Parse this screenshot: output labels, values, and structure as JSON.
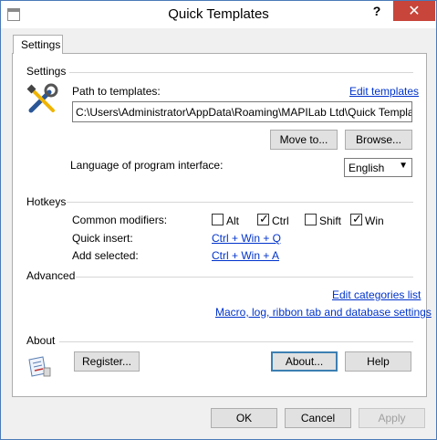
{
  "window": {
    "title": "Quick Templates",
    "help_glyph": "?",
    "close_glyph": "✕"
  },
  "tabs": [
    {
      "label": "Settings",
      "selected": true
    }
  ],
  "settings": {
    "section_title": "Settings",
    "path_label": "Path to templates:",
    "edit_templates_link": "Edit templates",
    "path_value": "C:\\Users\\Administrator\\AppData\\Roaming\\MAPILab Ltd\\Quick Templates\\Ou",
    "move_to_button": "Move to...",
    "browse_button": "Browse...",
    "language_label": "Language of program interface:",
    "language_value": "English"
  },
  "hotkeys": {
    "section_title": "Hotkeys",
    "modifiers_label": "Common modifiers:",
    "modifiers": [
      {
        "label": "Alt",
        "checked": false
      },
      {
        "label": "Ctrl",
        "checked": true
      },
      {
        "label": "Shift",
        "checked": false
      },
      {
        "label": "Win",
        "checked": true
      }
    ],
    "quick_insert_label": "Quick insert:",
    "quick_insert_value": "Ctrl + Win + Q",
    "add_selected_label": "Add selected:",
    "add_selected_value": "Ctrl + Win + A"
  },
  "advanced": {
    "section_title": "Advanced",
    "edit_categories_link": "Edit categories list",
    "macro_link": "Macro, log, ribbon tab and database settings"
  },
  "about": {
    "section_title": "About",
    "register_button": "Register...",
    "about_button": "About...",
    "help_button": "Help"
  },
  "footer": {
    "ok_button": "OK",
    "cancel_button": "Cancel",
    "apply_button": "Apply"
  },
  "icons": [
    "app-icon",
    "tools-icon",
    "about-icon"
  ]
}
